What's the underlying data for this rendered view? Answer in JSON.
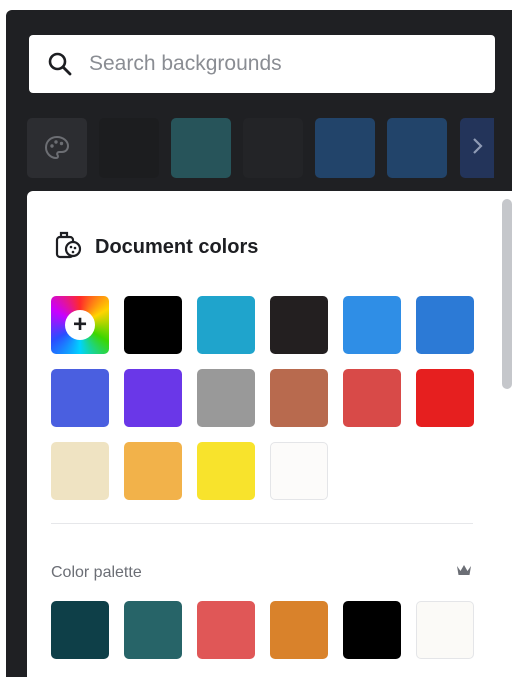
{
  "search": {
    "placeholder": "Search backgrounds",
    "icon": "search-icon"
  },
  "recent_colors": {
    "palette_icon": "palette-icon",
    "swatches": [
      "#1c1d1f",
      "#27545a",
      "#232427",
      "#22446a",
      "#22446a"
    ],
    "next_icon": "chevron-right-icon"
  },
  "document_colors": {
    "title": "Document colors",
    "icon": "document-colors-icon",
    "add_label": "+",
    "swatches": [
      "#000000",
      "#1fa4cc",
      "#231f20",
      "#2f8ee6",
      "#2c7ad6",
      "#4a5fe0",
      "#6a37e8",
      "#999999",
      "#b86a4e",
      "#d84a48",
      "#e61f1f",
      "#efe3c2",
      "#f2b24a",
      "#f8e32c",
      "#fcfbfa"
    ]
  },
  "color_palette": {
    "label": "Color palette",
    "icon": "crown-icon",
    "swatches": [
      "#0e3f48",
      "#276468",
      "#e05757",
      "#d9822b",
      "#000000",
      "#fbfaf7"
    ]
  }
}
